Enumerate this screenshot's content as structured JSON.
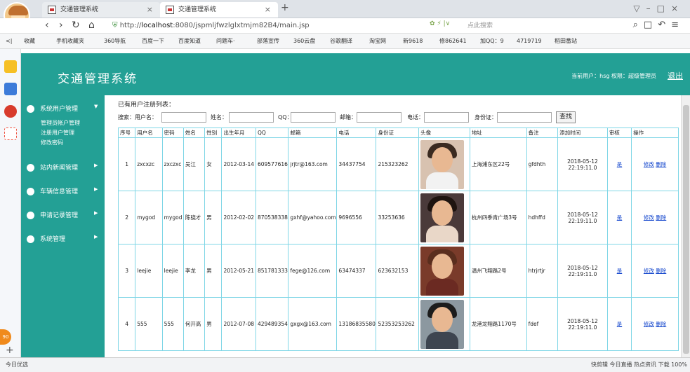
{
  "browser": {
    "tabs": [
      {
        "label": "交通管理系统"
      },
      {
        "label": "交通管理系统"
      }
    ],
    "url_prefix": "http://",
    "url_host": "localhost",
    "url_rest": ":8080/jspmljfwzlglxtmjm82B4/main.jsp",
    "search_placeholder": "点此搜索",
    "bookmarks": [
      "收藏",
      "手机收藏夹",
      "360导航",
      "百度一下",
      "百度知道",
      "问题车·",
      "部落宣传",
      "360云盘",
      "谷歌翻译",
      "淘宝网",
      "新9618",
      "修862641",
      "加QQ：9",
      "4719719",
      "稻田番站"
    ]
  },
  "app": {
    "title": "交通管理系统",
    "user_info": "当前用户：hsg  权限：超级管理员",
    "logout": "退出"
  },
  "sidebar": {
    "sections": [
      {
        "label": "系统用户管理",
        "sub": [
          "管理员帐户管理",
          "注册用户管理",
          "修改密码"
        ]
      },
      {
        "label": "站内新闻管理"
      },
      {
        "label": "车辆信息管理"
      },
      {
        "label": "申请记录管理"
      },
      {
        "label": "系统管理"
      }
    ]
  },
  "main": {
    "list_title": "已有用户注册列表：",
    "search": {
      "search_label": "搜索：用户名：",
      "name_label": "姓名：",
      "qq_label": "QQ：",
      "email_label": "邮箱：",
      "phone_label": "电话：",
      "idcard_label": "身份证：",
      "button": "查找"
    },
    "columns": [
      "序号",
      "用户名",
      "密码",
      "姓名",
      "性别",
      "出生年月",
      "QQ",
      "邮箱",
      "电话",
      "身份证",
      "头像",
      "地址",
      "备注",
      "添加时间",
      "审核",
      "操作"
    ],
    "rows": [
      {
        "no": "1",
        "user": "zxcxzc",
        "pwd": "zxczxc",
        "name": "吴江",
        "sex": "女",
        "birth": "2012-03-14",
        "qq": "609577616",
        "email": "jrjtr@163.com",
        "phone": "34437754",
        "idcard": "215323262",
        "address": "上海浦东区22号",
        "note": "gfdhth",
        "time": "2018-05-12 22:19:11.0",
        "audit": "是",
        "edit": "修改",
        "del": "删除"
      },
      {
        "no": "2",
        "user": "mygod",
        "pwd": "mygod",
        "name": "陈骁才",
        "sex": "男",
        "birth": "2012-02-02",
        "qq": "870538338",
        "email": "gxhf@yahoo.com",
        "phone": "9696556",
        "idcard": "33253636",
        "address": "杭州四季青广场3号",
        "note": "hdhffd",
        "time": "2018-05-12 22:19:11.0",
        "audit": "是",
        "edit": "修改",
        "del": "删除"
      },
      {
        "no": "3",
        "user": "leejie",
        "pwd": "leejie",
        "name": "李龙",
        "sex": "男",
        "birth": "2012-05-21",
        "qq": "851781333",
        "email": "fege@126.com",
        "phone": "63474337",
        "idcard": "623632153",
        "address": "温州飞翔路2号",
        "note": "htrjrtjr",
        "time": "2018-05-12 22:19:11.0",
        "audit": "是",
        "edit": "修改",
        "del": "删除"
      },
      {
        "no": "4",
        "user": "555",
        "pwd": "555",
        "name": "何开高",
        "sex": "男",
        "birth": "2012-07-08",
        "qq": "429489354",
        "email": "gxgx@163.com",
        "phone": "13186835580",
        "idcard": "52353253262",
        "address": "龙港龙翔路1170号",
        "note": "fdef",
        "time": "2018-05-12 22:19:11.0",
        "audit": "是",
        "edit": "修改",
        "del": "删除"
      }
    ]
  },
  "status": {
    "left": "今日优选",
    "right": "快剪辑   今日直播   热点资讯        下载         100%"
  },
  "badge": "90",
  "colors": {
    "accent": "#23a095",
    "table_border": "#7fd6e6",
    "link": "#1144cc"
  }
}
